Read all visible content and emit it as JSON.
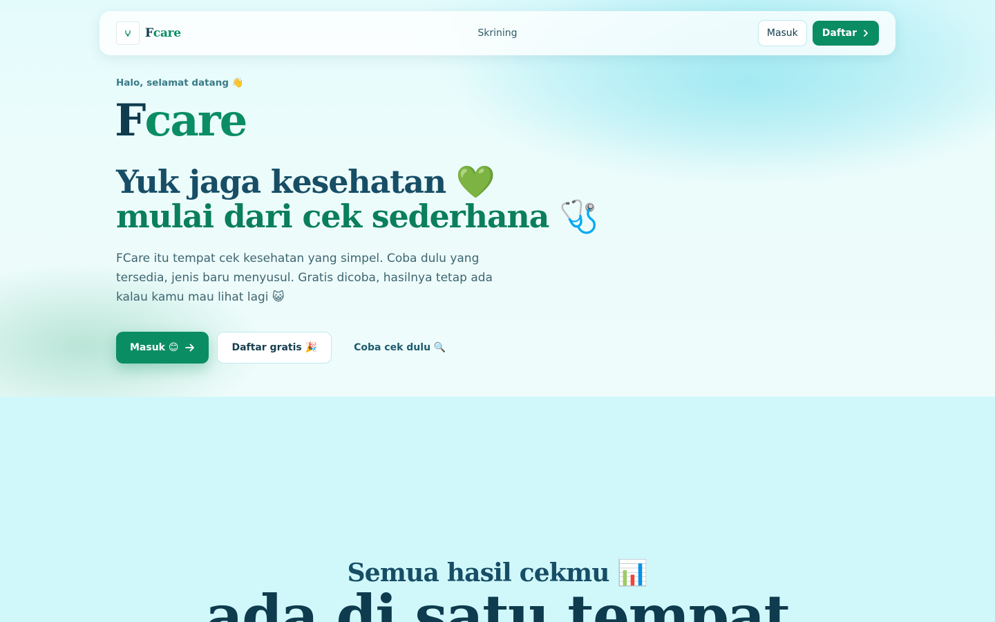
{
  "nav": {
    "brand_f": "F",
    "brand_rest": "care",
    "links": [
      "Skrining"
    ],
    "login_label": "Masuk",
    "register_label": "Daftar"
  },
  "hero": {
    "greeting": "Halo, selamat datang 👋",
    "title_f": "F",
    "title_rest": "care",
    "tagline_line1": "Yuk jaga kesehatan 💚",
    "tagline_line2": "mulai dari cek sederhana 🩺",
    "description": "FCare itu tempat cek kesehatan yang simpel. Coba dulu yang tersedia, jenis baru menyusul. Gratis dicoba, hasilnya tetap ada kalau kamu mau lihat lagi 😺",
    "cta_login": "Masuk 😊",
    "cta_register": "Daftar gratis 🎉",
    "cta_try": "Coba cek dulu 🔍"
  },
  "section": {
    "subtitle": "Semua hasil cekmu 📊",
    "title": "ada di satu tempat"
  },
  "colors": {
    "primary": "#0a8d63",
    "dark": "#0e3b4d",
    "background": "#d3f8fb"
  }
}
